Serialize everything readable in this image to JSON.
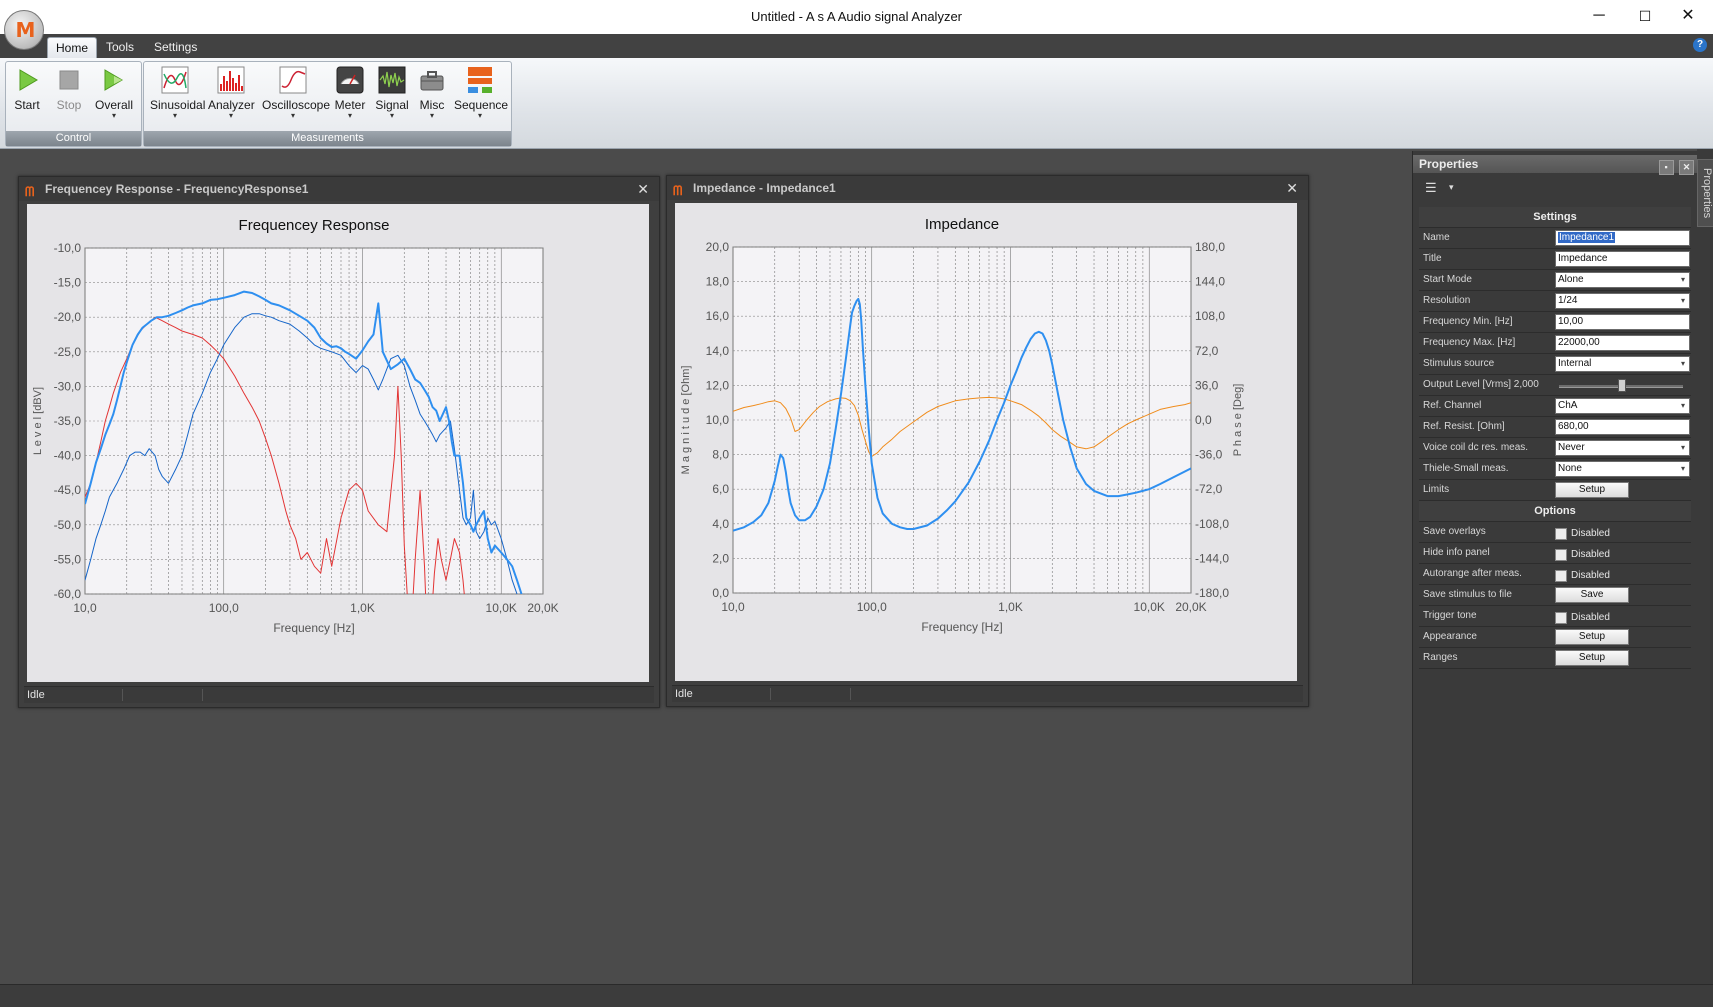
{
  "window": {
    "title": "Untitled - A s A  Audio signal Analyzer",
    "controls": {
      "minimize": "─",
      "maximize": "☐",
      "close": "✕"
    }
  },
  "app_logo": {
    "glyph": "M"
  },
  "tabs": [
    "Home",
    "Tools",
    "Settings"
  ],
  "active_tab": "Home",
  "help_glyph": "?",
  "ribbon": {
    "control": {
      "label": "Control",
      "buttons": [
        {
          "label": "Start",
          "icon": "play-icon",
          "enabled": true
        },
        {
          "label": "Stop",
          "icon": "stop-icon",
          "enabled": false
        },
        {
          "label": "Overall",
          "icon": "play-overall-icon",
          "enabled": true,
          "dropdown": "▾"
        }
      ]
    },
    "measurements": {
      "label": "Measurements",
      "buttons": [
        {
          "label": "Sinusoidal",
          "icon": "sinusoidal-icon",
          "dropdown": "▾"
        },
        {
          "label": "Analyzer",
          "icon": "analyzer-icon",
          "dropdown": "▾"
        },
        {
          "label": "Oscilloscope",
          "icon": "oscilloscope-icon",
          "dropdown": "▾"
        },
        {
          "label": "Meter",
          "icon": "meter-icon",
          "dropdown": "▾"
        },
        {
          "label": "Signal",
          "icon": "signal-icon",
          "dropdown": "▾"
        },
        {
          "label": "Misc",
          "icon": "toolbox-icon",
          "dropdown": "▾"
        },
        {
          "label": "Sequence",
          "icon": "sequence-icon",
          "dropdown": "▾"
        }
      ]
    }
  },
  "panels": {
    "freq": {
      "title": "Frequencey Response - FrequencyResponse1",
      "status": "Idle",
      "close": "✕"
    },
    "imp": {
      "title": "Impedance - Impedance1",
      "status": "Idle",
      "close": "✕"
    }
  },
  "chart_data": [
    {
      "type": "line",
      "title": "Frequencey Response",
      "xlabel": "Frequency [Hz]",
      "ylabel": "L e v e l  [dBV]",
      "x_scale": "log",
      "xlim": [
        10,
        20000
      ],
      "ylim": [
        -60,
        -10
      ],
      "x_tick_labels": [
        "10,0",
        "100,0",
        "1,0K",
        "10,0K",
        "20,0K"
      ],
      "x_ticks": [
        10,
        100,
        1000,
        10000,
        20000
      ],
      "y_tick_labels": [
        "-10,0",
        "-15,0",
        "-20,0",
        "-25,0",
        "-30,0",
        "-35,0",
        "-40,0",
        "-45,0",
        "-50,0",
        "-55,0",
        "-60,0"
      ],
      "y_ticks": [
        -10,
        -15,
        -20,
        -25,
        -30,
        -35,
        -40,
        -45,
        -50,
        -55,
        -60
      ],
      "grid": true,
      "series": [
        {
          "color": "#e23434",
          "width": 1,
          "x": [
            10,
            11,
            12,
            13,
            14,
            15,
            16,
            18,
            20,
            22,
            25,
            28,
            32,
            36,
            40,
            45,
            50,
            60,
            70,
            80,
            90,
            100,
            120,
            140,
            160,
            180,
            200,
            220,
            250,
            280,
            300,
            330,
            360,
            400,
            450,
            500,
            550,
            600,
            700,
            800,
            900,
            1000,
            1100,
            1300,
            1500,
            1700,
            1800,
            1900,
            2000,
            2100,
            2200,
            2400,
            2600,
            2800,
            3000,
            3100,
            3300,
            3500,
            3700,
            4000,
            4300,
            4600,
            5000,
            5300,
            5700,
            6000
          ],
          "y": [
            -46,
            -44,
            -41,
            -38,
            -35,
            -33,
            -31,
            -28,
            -26,
            -24,
            -22,
            -21,
            -20,
            -20.5,
            -21,
            -21.5,
            -22,
            -22.5,
            -23,
            -24,
            -25,
            -26,
            -28.5,
            -31,
            -33,
            -35,
            -37.5,
            -40,
            -44,
            -48,
            -50,
            -52,
            -55,
            -54,
            -56,
            -57,
            -52,
            -56,
            -49,
            -45,
            -44,
            -45,
            -48,
            -50,
            -51,
            -40,
            -30,
            -40,
            -53,
            -60,
            -68,
            -55,
            -45,
            -56,
            -72,
            -65,
            -57,
            -52,
            -55,
            -58,
            -55,
            -52,
            -54,
            -58,
            -65,
            -70
          ]
        },
        {
          "color": "#1565c9",
          "width": 1,
          "x": [
            10,
            11,
            12,
            13,
            14,
            15,
            17,
            19,
            21,
            23,
            25,
            27,
            29,
            32,
            34,
            36,
            40,
            45,
            50,
            55,
            60,
            70,
            80,
            90,
            100,
            120,
            140,
            160,
            180,
            200,
            220,
            250,
            300,
            350,
            400,
            450,
            500,
            600,
            700,
            800,
            900,
            1000,
            1100,
            1200,
            1300,
            1400,
            1600,
            1800,
            2000,
            2200,
            2400,
            2600,
            2800,
            3000,
            3200,
            3400,
            3600,
            4000,
            4300,
            4600,
            5000,
            5300,
            5600,
            6000,
            6300,
            6600,
            7000,
            7500,
            8000,
            8500,
            9000,
            10000,
            11000,
            12000,
            13000,
            14000
          ],
          "y": [
            -58,
            -55,
            -52,
            -50,
            -48,
            -46,
            -44,
            -42,
            -40,
            -39.5,
            -39.5,
            -40,
            -39,
            -40,
            -42,
            -43,
            -44,
            -42,
            -40,
            -37,
            -34,
            -31,
            -28,
            -26,
            -24,
            -21.5,
            -20,
            -19.5,
            -19.5,
            -19.8,
            -20,
            -20.5,
            -21,
            -22,
            -23,
            -24,
            -24.5,
            -25,
            -25.5,
            -27,
            -28,
            -27,
            -27.5,
            -29,
            -30.5,
            -29,
            -26,
            -25.5,
            -27,
            -30,
            -32,
            -34,
            -35,
            -36,
            -37,
            -38,
            -37,
            -36,
            -35,
            -39,
            -45,
            -49,
            -50,
            -49,
            -45,
            -51,
            -52,
            -51,
            -49,
            -50,
            -49.5,
            -52,
            -55,
            -58,
            -60,
            -61
          ]
        },
        {
          "color": "#2e8ff0",
          "width": 2,
          "x": [
            10,
            11,
            12,
            13,
            14,
            15,
            16,
            17,
            18,
            19,
            20,
            22,
            24,
            26,
            28,
            30,
            33,
            36,
            40,
            45,
            50,
            55,
            60,
            70,
            80,
            90,
            100,
            120,
            140,
            160,
            180,
            200,
            220,
            250,
            300,
            350,
            400,
            450,
            500,
            550,
            600,
            650,
            700,
            750,
            800,
            900,
            1000,
            1100,
            1200,
            1300,
            1400,
            1600,
            1800,
            2000,
            2200,
            2400,
            2600,
            2800,
            3000,
            3200,
            3400,
            3600,
            4000,
            4200,
            4400,
            4600,
            5000,
            5300,
            5600,
            6000,
            6300,
            6600,
            7000,
            7500,
            8000,
            8500,
            9000,
            10000,
            11000,
            12000,
            13000,
            14000
          ],
          "y": [
            -47,
            -44,
            -41,
            -39,
            -37,
            -35.5,
            -34,
            -32,
            -30,
            -28,
            -26.5,
            -24,
            -22.5,
            -21.5,
            -21,
            -20.5,
            -20,
            -20,
            -19.8,
            -19.4,
            -19,
            -18.6,
            -18.3,
            -18,
            -17.5,
            -17.4,
            -17.2,
            -16.8,
            -16.3,
            -16.5,
            -17,
            -17.5,
            -18,
            -18.3,
            -19,
            -19.8,
            -20.5,
            -21.5,
            -23,
            -23.8,
            -24.3,
            -24.2,
            -24.5,
            -25,
            -25.3,
            -26,
            -24.8,
            -23.5,
            -22.5,
            -18,
            -25,
            -27.5,
            -26.8,
            -26,
            -27.5,
            -29,
            -29.5,
            -30.5,
            -31.5,
            -33,
            -33.5,
            -35,
            -33,
            -35,
            -38,
            -40,
            -40,
            -44,
            -49,
            -50,
            -51,
            -50,
            -49,
            -48,
            -52,
            -54,
            -53,
            -54,
            -55,
            -56,
            -58,
            -60
          ]
        }
      ]
    },
    {
      "type": "line",
      "title": "Impedance",
      "xlabel": "Frequency [Hz]",
      "ylabel": "M a g n i t u d e  [Ohm]",
      "y2label": "P h a s e  [Deg]",
      "x_scale": "log",
      "xlim": [
        10,
        20000
      ],
      "ylim": [
        0,
        20
      ],
      "y2lim": [
        -180,
        180
      ],
      "x_tick_labels": [
        "10,0",
        "100,0",
        "1,0K",
        "10,0K",
        "20,0K"
      ],
      "x_ticks": [
        10,
        100,
        1000,
        10000,
        20000
      ],
      "y_tick_labels": [
        "20,0",
        "18,0",
        "16,0",
        "14,0",
        "12,0",
        "10,0",
        "8,0",
        "6,0",
        "4,0",
        "2,0",
        "0,0"
      ],
      "y_ticks": [
        20,
        18,
        16,
        14,
        12,
        10,
        8,
        6,
        4,
        2,
        0
      ],
      "y2_tick_labels": [
        "180,0",
        "144,0",
        "108,0",
        "72,0",
        "36,0",
        "0,0",
        "-36,0",
        "-72,0",
        "-108,0",
        "-144,0",
        "-180,0"
      ],
      "y2_ticks": [
        180,
        144,
        108,
        72,
        36,
        0,
        -36,
        -72,
        -108,
        -144,
        -180
      ],
      "grid": true,
      "series": [
        {
          "color": "#f08c1c",
          "axis": "y2",
          "width": 1,
          "x": [
            10,
            12,
            14,
            16,
            18,
            20,
            22,
            24,
            26,
            28,
            30,
            34,
            38,
            42,
            48,
            55,
            60,
            65,
            70,
            75,
            80,
            85,
            90,
            95,
            100,
            110,
            120,
            140,
            160,
            200,
            250,
            300,
            400,
            500,
            600,
            700,
            800,
            900,
            1000,
            1200,
            1400,
            1600,
            1800,
            2000,
            2300,
            2600,
            3000,
            3500,
            4000,
            4500,
            5000,
            6000,
            7000,
            8000,
            10000,
            12000,
            15000,
            18000,
            20000
          ],
          "y": [
            9,
            13,
            15,
            17,
            19,
            20,
            18,
            12,
            2,
            -12,
            -10,
            0,
            8,
            14,
            19,
            22,
            23,
            22.5,
            20,
            15,
            5,
            -10,
            -22,
            -33,
            -38,
            -34,
            -28,
            -20,
            -12,
            -2,
            8,
            14,
            20,
            22,
            23,
            23.5,
            23,
            22,
            20,
            16,
            10,
            4,
            -3,
            -10,
            -17,
            -22,
            -28,
            -30,
            -28,
            -23,
            -18,
            -10,
            -4,
            0,
            6,
            11,
            14,
            16,
            18
          ]
        },
        {
          "color": "#2e8ff0",
          "axis": "y",
          "width": 2,
          "x": [
            10,
            12,
            14,
            16,
            18,
            20,
            21,
            22,
            23,
            24,
            25,
            26,
            28,
            30,
            33,
            36,
            40,
            45,
            50,
            55,
            60,
            65,
            70,
            72,
            75,
            78,
            80,
            82,
            84,
            86,
            90,
            95,
            100,
            110,
            120,
            140,
            160,
            180,
            200,
            250,
            300,
            350,
            400,
            500,
            600,
            700,
            800,
            900,
            1000,
            1100,
            1200,
            1300,
            1400,
            1500,
            1600,
            1700,
            1800,
            1900,
            2000,
            2200,
            2400,
            2700,
            3000,
            3500,
            4000,
            5000,
            6000,
            7000,
            8000,
            10000,
            12000,
            15000,
            20000
          ],
          "y": [
            3.6,
            3.8,
            4.1,
            4.5,
            5.2,
            6.5,
            7.3,
            8,
            7.8,
            7,
            6,
            5.2,
            4.5,
            4.2,
            4.2,
            4.4,
            5,
            6,
            7.5,
            9.5,
            11.5,
            13.5,
            15.5,
            16.2,
            16.6,
            16.9,
            17,
            16.7,
            15.8,
            14.3,
            12,
            9.5,
            7.5,
            5.5,
            4.6,
            4,
            3.8,
            3.7,
            3.7,
            3.9,
            4.3,
            4.8,
            5.3,
            6.4,
            7.6,
            8.8,
            10,
            11,
            12,
            12.8,
            13.6,
            14.2,
            14.7,
            15,
            15.1,
            15,
            14.6,
            14,
            13.2,
            11.5,
            10,
            8.4,
            7.2,
            6.3,
            5.9,
            5.6,
            5.6,
            5.7,
            5.8,
            6,
            6.3,
            6.7,
            7.2
          ]
        }
      ]
    }
  ],
  "properties": {
    "header": "Properties",
    "header_btns": [
      "▪",
      "✕"
    ],
    "side_tab": "Properties",
    "toolbar_icon": "list-view-icon",
    "toolbar_glyph": "☰",
    "toolbar_dropdown": "▾",
    "settings_label": "Settings",
    "options_label": "Options",
    "settings": [
      {
        "name": "Name",
        "value": "Impedance1",
        "kind": "text-selected"
      },
      {
        "name": "Title",
        "value": "Impedance",
        "kind": "text"
      },
      {
        "name": "Start Mode",
        "value": "Alone",
        "kind": "select"
      },
      {
        "name": "Resolution",
        "value": "1/24",
        "kind": "select"
      },
      {
        "name": "Frequency Min. [Hz]",
        "value": "10,00",
        "kind": "text"
      },
      {
        "name": "Frequency Max. [Hz]",
        "value": "22000,00",
        "kind": "text"
      },
      {
        "name": "Stimulus source",
        "value": "Internal",
        "kind": "select"
      },
      {
        "name": "Output Level [Vrms] 2,000",
        "value": "",
        "kind": "slider",
        "level": 0.5
      },
      {
        "name": "Ref. Channel",
        "value": "ChA",
        "kind": "select"
      },
      {
        "name": "Ref. Resist. [Ohm]",
        "value": "680,00",
        "kind": "text"
      },
      {
        "name": "Voice coil dc res. meas.",
        "value": "Never",
        "kind": "select"
      },
      {
        "name": "Thiele-Small meas.",
        "value": "None",
        "kind": "select"
      },
      {
        "name": "Limits",
        "value": "Setup",
        "kind": "button"
      }
    ],
    "options": [
      {
        "name": "Save overlays",
        "value": "Disabled",
        "kind": "checkbox"
      },
      {
        "name": "Hide info panel",
        "value": "Disabled",
        "kind": "checkbox"
      },
      {
        "name": "Autorange after meas.",
        "value": "Disabled",
        "kind": "checkbox"
      },
      {
        "name": "Save stimulus to file",
        "value": "Save",
        "kind": "button"
      },
      {
        "name": "Trigger tone",
        "value": "Disabled",
        "kind": "checkbox"
      },
      {
        "name": "Appearance",
        "value": "Setup",
        "kind": "button"
      },
      {
        "name": "Ranges",
        "value": "Setup",
        "kind": "button"
      }
    ]
  },
  "select_caret": "▾"
}
